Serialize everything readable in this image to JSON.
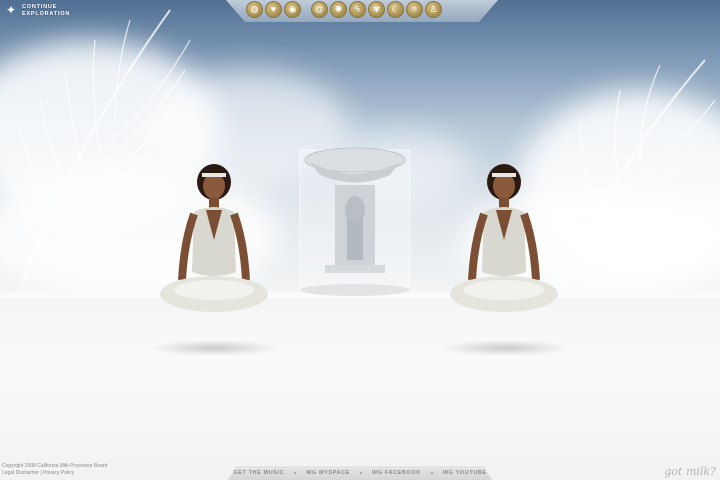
{
  "header": {
    "logo_line1": "CONTINUE",
    "logo_line2": "EXPLORATION",
    "nav_icons": [
      "milk-drop-icon",
      "heart-icon",
      "eye-icon",
      "swirl-icon",
      "sun-icon",
      "lightning-icon",
      "lotus-icon",
      "crescent-icon",
      "atom-icon",
      "figure-icon"
    ]
  },
  "footer": {
    "copyright": "Copyright 2008 California Milk Processor Board",
    "legal": "Legal Disclaimer",
    "separator": "|",
    "privacy": "Privacy Policy",
    "links": [
      "GET THE MUSIC",
      "WG MYSPACE",
      "WG FACEBOOK",
      "WG YOUTUBE"
    ],
    "brand": "got milk?"
  },
  "colors": {
    "icon_gold": "#a48c4c",
    "sky_top": "#4f6f93",
    "floor": "#f4f4f4"
  }
}
